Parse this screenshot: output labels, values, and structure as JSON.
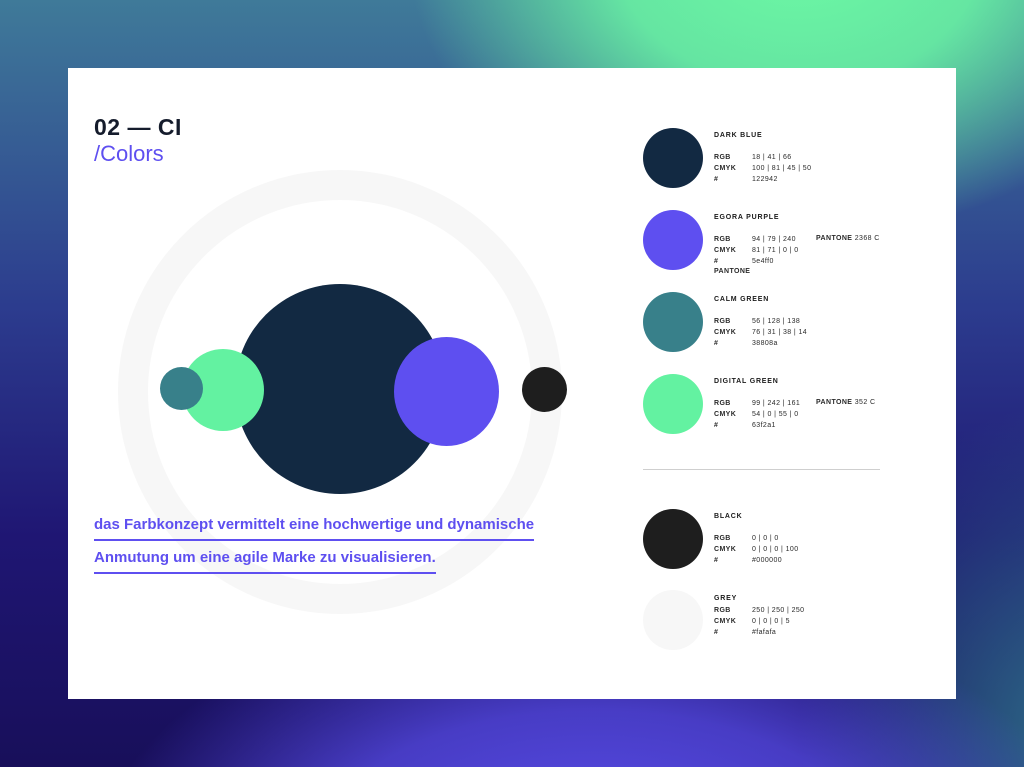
{
  "header": {
    "title": "02 — CI",
    "subtitle": "/Colors"
  },
  "tagline": {
    "line1": "das Farbkonzept vermittelt eine hochwertige und dynamische",
    "line2": "Anmutung um eine agile Marke zu visualisieren."
  },
  "illustration_colors": {
    "ring": "#f7f7f7",
    "big": "#122942",
    "purple": "#5e4ff0",
    "green": "#63f2a1",
    "teal": "#38808a",
    "black": "#1e1e1e"
  },
  "palette": [
    {
      "name": "DARK BLUE",
      "hex_color": "#122942",
      "rgb_label": "RGB",
      "rgb": "18 | 41 | 66",
      "cmyk_label": "CMYK",
      "cmyk": "100 | 81 | 45 | 50",
      "hex_label": "#",
      "hex": "122942"
    },
    {
      "name": "EGORA PURPLE",
      "hex_color": "#5e4ff0",
      "rgb_label": "RGB",
      "rgb": "94 | 79 | 240",
      "cmyk_label": "CMYK",
      "cmyk": "81 | 71 | 0 | 0",
      "hex_label": "#",
      "hex": "5e4ff0",
      "pantone_label": "PANTONE",
      "pantone": "2368 C",
      "pantone_sub": "PANTONE"
    },
    {
      "name": "CALM GREEN",
      "hex_color": "#38808a",
      "rgb_label": "RGB",
      "rgb": "56 | 128 | 138",
      "cmyk_label": "CMYK",
      "cmyk": "76 | 31 | 38 | 14",
      "hex_label": "#",
      "hex": "38808a"
    },
    {
      "name": "DIGITAL GREEN",
      "hex_color": "#63f2a1",
      "rgb_label": "RGB",
      "rgb": "99 | 242 | 161",
      "cmyk_label": "CMYK",
      "cmyk": "54 | 0 | 55 | 0",
      "hex_label": "#",
      "hex": "63f2a1",
      "pantone_label": "PANTONE",
      "pantone": "352 C"
    },
    {
      "name": "BLACK",
      "hex_color": "#1e1e1e",
      "rgb_label": "RGB",
      "rgb": "0 | 0 | 0",
      "cmyk_label": "CMYK",
      "cmyk": "0 | 0 | 0 | 100",
      "hex_label": "#",
      "hex": "#000000"
    },
    {
      "name": "GREY",
      "hex_color": "#f7f7f7",
      "rgb_label": "RGB",
      "rgb": "250 | 250 | 250",
      "cmyk_label": "CMYK",
      "cmyk": "0 | 0 | 0 | 5",
      "hex_label": "#",
      "hex": "#fafafa"
    }
  ]
}
